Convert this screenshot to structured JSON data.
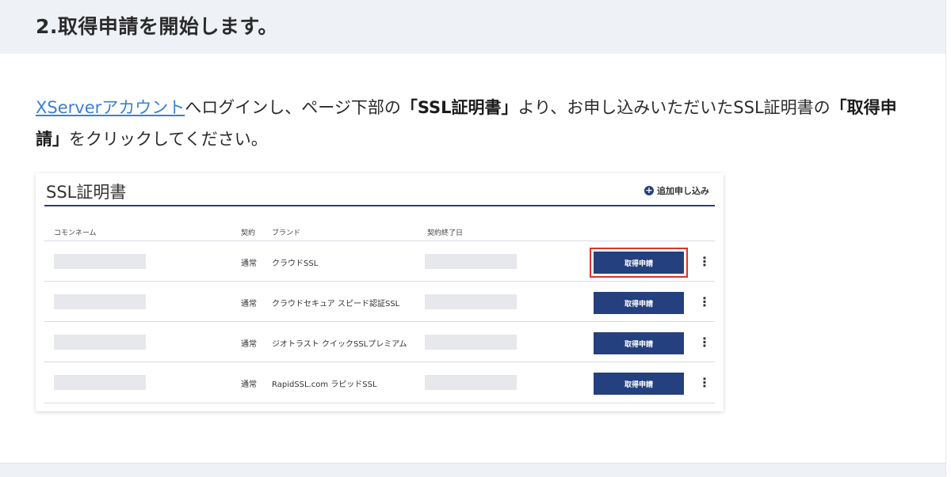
{
  "step": {
    "title": "2.取得申請を開始します。"
  },
  "description": {
    "link_text": "XServerアカウント",
    "text_1": "へログインし、ページ下部の",
    "bold_1": "「SSL証明書」",
    "text_2": "より、お申し込みいただいたSSL証明書の",
    "bold_2": "「取得申請」",
    "text_3": "をクリックしてください。"
  },
  "screenshot": {
    "title": "SSL証明書",
    "add_link": "追加申し込み",
    "columns": {
      "common_name": "コモンネーム",
      "contract": "契約",
      "brand": "ブランド",
      "end_date": "契約終了日"
    },
    "rows": [
      {
        "type": "通常",
        "brand": "クラウドSSL",
        "button": "取得申請",
        "highlighted": true
      },
      {
        "type": "通常",
        "brand": "クラウドセキュア スピード認証SSL",
        "button": "取得申請",
        "highlighted": false
      },
      {
        "type": "通常",
        "brand": "ジオトラスト クイックSSLプレミアム",
        "button": "取得申請",
        "highlighted": false
      },
      {
        "type": "通常",
        "brand": "RapidSSL.com ラピッドSSL",
        "button": "取得申請",
        "highlighted": false
      }
    ],
    "more_icon": "⋮"
  },
  "colors": {
    "header_bg": "#eef1f6",
    "link": "#3c7fd0",
    "button": "#25407f",
    "highlight": "#e0302c"
  }
}
